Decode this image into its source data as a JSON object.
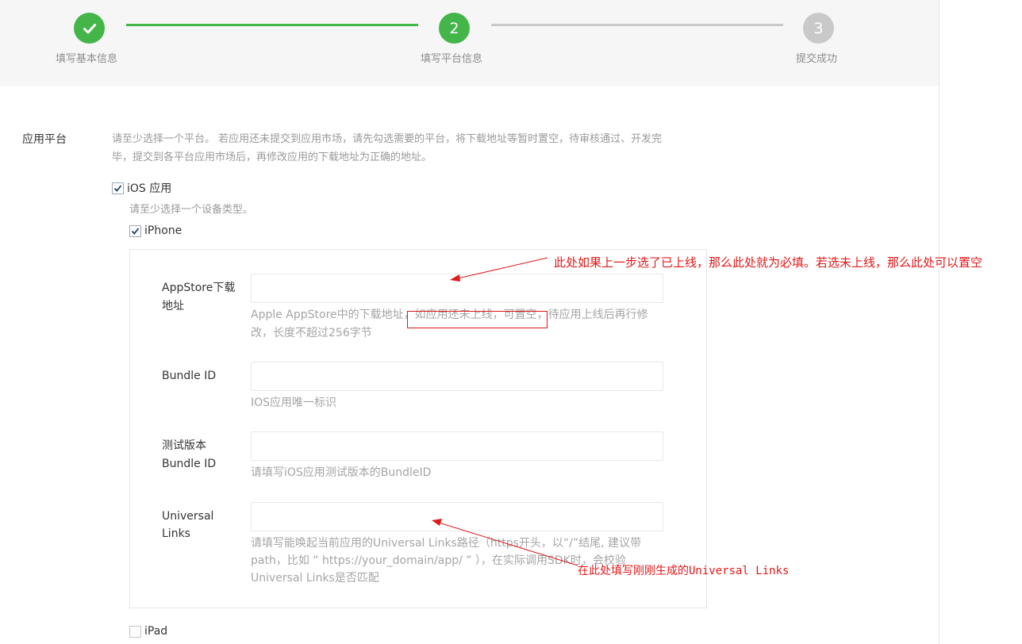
{
  "steps": [
    {
      "label": "填写基本信息",
      "number": "",
      "state": "done"
    },
    {
      "label": "填写平台信息",
      "number": "2",
      "state": "current"
    },
    {
      "label": "提交成功",
      "number": "3",
      "state": "todo"
    }
  ],
  "app_platform": {
    "label": "应用平台",
    "description_line1": "请至少选择一个平台。 若应用还未提交到应用市场，请先勾选需要的平台，将下载地址等暂时置空，待审核通过、开发完",
    "description_line2": "毕，提交到各平台应用市场后，再修改应用的下载地址为正确的地址。",
    "ios_checkbox": {
      "label": "iOS 应用",
      "checked": true
    },
    "device_hint": "请至少选择一个设备类型。",
    "iphone_checkbox": {
      "label": "iPhone",
      "checked": true
    },
    "ipad_checkbox": {
      "label": "iPad",
      "checked": false
    }
  },
  "form": {
    "appstore": {
      "label_line1": "AppStore下载",
      "label_line2": "地址",
      "value": "",
      "hint_line1": "Apple AppStore中的下载地址，如应用还未上线，可置空，待应用上线后再行修",
      "hint_line2": "改，长度不超过256字节"
    },
    "bundle_id": {
      "label": "Bundle ID",
      "value": "",
      "hint": "IOS应用唯一标识"
    },
    "test_bundle_id": {
      "label_line1": "测试版本",
      "label_line2": "Bundle ID",
      "value": "",
      "hint": "请填写iOS应用测试版本的BundleID"
    },
    "universal_links": {
      "label_line1": "Universal",
      "label_line2": "Links",
      "value": "",
      "hint_line1": "请填写能唤起当前应用的Universal Links路径（https开头，以“/”结尾, 建议带",
      "hint_line2": "path，比如 “ https://your_domain/app/ ” ），在实际调用SDK时，会校验",
      "hint_line3": "Universal Links是否匹配"
    }
  },
  "annotations": {
    "appstore_note": "此处如果上一步选了已上线，那么此处就为必填。若选未上线，那么此处可以置空",
    "universal_links_note": "在此处填写刚刚生成的Universal Links",
    "color": "#e0191a"
  },
  "colors": {
    "accent": "#44b549",
    "inactive": "#c9c9c9"
  }
}
